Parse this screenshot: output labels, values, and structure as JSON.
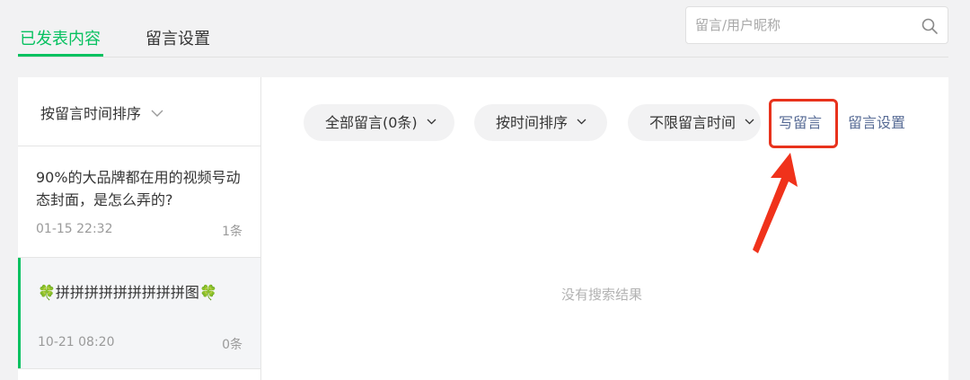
{
  "tabs": [
    {
      "label": "已发表内容"
    },
    {
      "label": "留言设置"
    }
  ],
  "search": {
    "placeholder": "留言/用户昵称"
  },
  "sort": {
    "label": "按留言时间排序"
  },
  "articles": [
    {
      "title": "90%的大品牌都在用的视频号动态封面，是怎么弄的?",
      "date": "01-15 22:32",
      "count": "1条"
    },
    {
      "title_prefix": "🍀",
      "title": "拼拼拼拼拼拼拼拼拼图",
      "title_suffix": "🍀",
      "date": "10-21 08:20",
      "count": "0条"
    }
  ],
  "filters": [
    {
      "label": "全部留言(0条)"
    },
    {
      "label": "按时间排序"
    },
    {
      "label": "不限留言时间"
    }
  ],
  "actions": {
    "write": "写留言",
    "settings": "留言设置"
  },
  "empty_state": "没有搜索结果",
  "colors": {
    "accent": "#07c160",
    "link": "#576b95",
    "highlight": "#e8321c"
  }
}
